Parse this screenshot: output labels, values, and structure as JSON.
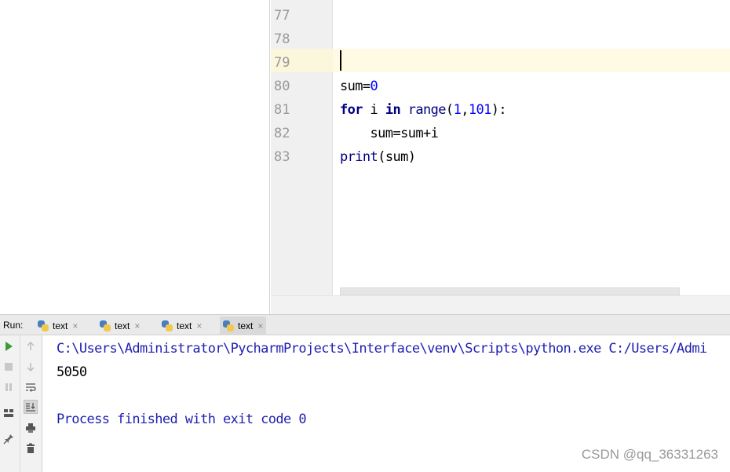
{
  "editor": {
    "line_numbers": [
      "77",
      "78",
      "79",
      "80",
      "81",
      "82",
      "83"
    ],
    "code": {
      "line80": {
        "var": "sum",
        "op": "=",
        "num": "0"
      },
      "line81": {
        "kw_for": "for",
        "var": " i ",
        "kw_in": "in",
        "space": " ",
        "fn": "range",
        "open": "(",
        "n1": "1",
        "comma": ",",
        "n2": "101",
        "close": "):"
      },
      "line82": {
        "text": "    sum=sum+i"
      },
      "line83": {
        "fn": "print",
        "args": "(sum)"
      }
    }
  },
  "run": {
    "label": "Run:",
    "tabs": [
      {
        "label": "text",
        "close": "×"
      },
      {
        "label": "text",
        "close": "×"
      },
      {
        "label": "text",
        "close": "×"
      },
      {
        "label": "text",
        "close": "×"
      }
    ],
    "active_tab_index": 3
  },
  "console": {
    "command": "C:\\Users\\Administrator\\PycharmProjects\\Interface\\venv\\Scripts\\python.exe C:/Users/Admi",
    "output": "5050",
    "exit_message": "Process finished with exit code 0"
  },
  "icons": {
    "run_tools": [
      "run-icon",
      "stop-icon",
      "pause-icon",
      "layout-icon",
      "pin-icon"
    ],
    "console_tools": [
      "up-arrow-icon",
      "down-arrow-icon",
      "soft-wrap-icon",
      "scroll-to-end-icon",
      "print-icon",
      "trash-icon"
    ]
  },
  "colors": {
    "keyword": "#000080",
    "number": "#0000ff",
    "console_path": "#1f1fb0",
    "caret_row": "#fffae3",
    "run_icon_green": "#3c9a3c"
  },
  "watermark": "CSDN @qq_36331263"
}
